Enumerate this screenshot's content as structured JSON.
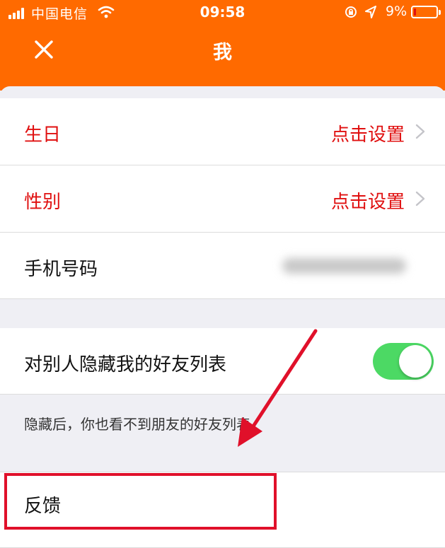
{
  "status_bar": {
    "carrier": "中国电信",
    "time": "09:58",
    "battery_percent": "9%",
    "battery_level": 0.09,
    "icons": [
      "signal-bars-icon",
      "wifi-icon",
      "orientation-lock-icon",
      "location-arrow-icon",
      "battery-icon"
    ]
  },
  "nav": {
    "title": "我",
    "close_icon": "close-icon"
  },
  "profile": {
    "birthday": {
      "label": "生日",
      "value": "点击设置"
    },
    "gender": {
      "label": "性别",
      "value": "点击设置"
    },
    "phone": {
      "label": "手机号码",
      "value_redacted": true
    }
  },
  "privacy": {
    "hide_friends_label": "对别人隐藏我的好友列表",
    "hide_friends_enabled": true,
    "hint": "隐藏后，你也看不到朋友的好友列表"
  },
  "feedback": {
    "label": "反馈"
  },
  "colors": {
    "header": "#ff6a00",
    "accent_red": "#e01010",
    "toggle_on": "#4cd964",
    "annotation": "#e0102a",
    "background": "#efeff4"
  }
}
